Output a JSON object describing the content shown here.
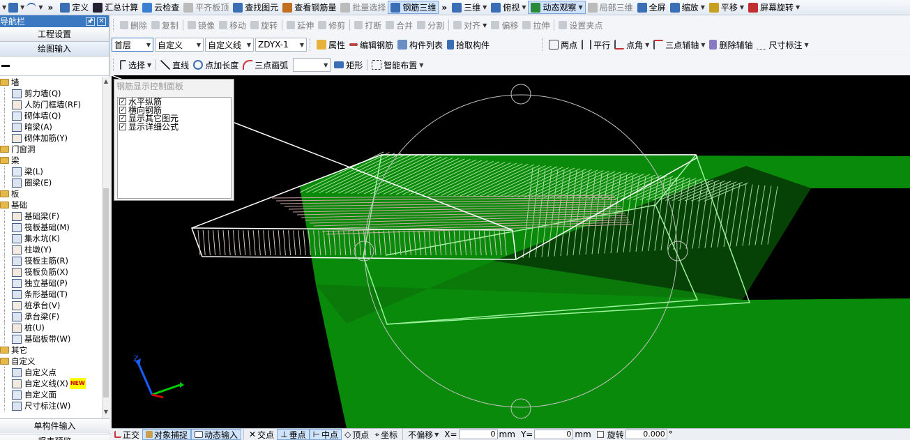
{
  "toolbar_top": {
    "items": [
      {
        "label": "定义",
        "icon": "define-icon",
        "active": false,
        "dim": false
      },
      {
        "label": "汇总计算",
        "icon": "sigma-icon",
        "active": false,
        "dim": false
      },
      {
        "label": "云检查",
        "icon": "cloud-check-icon",
        "active": false,
        "dim": false
      },
      {
        "label": "平齐板顶",
        "icon": "align-slab-icon",
        "active": false,
        "dim": true
      },
      {
        "label": "查找图元",
        "icon": "find-icon",
        "active": false,
        "dim": false
      },
      {
        "label": "查看钢筋量",
        "icon": "view-rebar-icon",
        "active": false,
        "dim": false
      },
      {
        "label": "批量选择",
        "icon": "batch-select-icon",
        "active": false,
        "dim": true
      },
      {
        "label": "钢筋三维",
        "icon": "rebar-3d-icon",
        "active": true,
        "dim": false
      },
      {
        "label": "三维",
        "icon": "cube-icon",
        "active": false,
        "dim": false
      },
      {
        "label": "俯视",
        "icon": "top-view-icon",
        "active": false,
        "dim": false
      },
      {
        "label": "动态观察",
        "icon": "orbit-icon",
        "active": true,
        "dim": false
      },
      {
        "label": "局部三维",
        "icon": "local-3d-icon",
        "active": false,
        "dim": true
      },
      {
        "label": "全屏",
        "icon": "fullscreen-icon",
        "active": false,
        "dim": false
      },
      {
        "label": "缩放",
        "icon": "zoom-icon",
        "active": false,
        "dim": false
      },
      {
        "label": "平移",
        "icon": "pan-icon",
        "active": false,
        "dim": false
      },
      {
        "label": "屏幕旋转",
        "icon": "rotate-screen-icon",
        "active": false,
        "dim": false
      }
    ]
  },
  "nav": {
    "title": "导航栏",
    "engineering_settings": "工程设置",
    "drawing_input": "绘图输入",
    "single_component_input": "单构件输入",
    "report_preview": "报表预览",
    "tree": [
      {
        "type": "cat",
        "label": "墙"
      },
      {
        "type": "leaf",
        "label": "剪力墙(Q)"
      },
      {
        "type": "leaf",
        "label": "人防门框墙(RF)"
      },
      {
        "type": "leaf",
        "label": "砌体墙(Q)"
      },
      {
        "type": "leaf",
        "label": "暗梁(A)"
      },
      {
        "type": "leaf",
        "label": "砌体加筋(Y)"
      },
      {
        "type": "cat",
        "label": "门窗洞"
      },
      {
        "type": "cat",
        "label": "梁"
      },
      {
        "type": "leaf",
        "label": "梁(L)"
      },
      {
        "type": "leaf",
        "label": "圈梁(E)"
      },
      {
        "type": "cat",
        "label": "板"
      },
      {
        "type": "cat",
        "label": "基础"
      },
      {
        "type": "leaf",
        "label": "基础梁(F)"
      },
      {
        "type": "leaf",
        "label": "筏板基础(M)"
      },
      {
        "type": "leaf",
        "label": "集水坑(K)"
      },
      {
        "type": "leaf",
        "label": "柱墩(Y)"
      },
      {
        "type": "leaf",
        "label": "筏板主筋(R)"
      },
      {
        "type": "leaf",
        "label": "筏板负筋(X)"
      },
      {
        "type": "leaf",
        "label": "独立基础(P)"
      },
      {
        "type": "leaf",
        "label": "条形基础(T)"
      },
      {
        "type": "leaf",
        "label": "桩承台(V)"
      },
      {
        "type": "leaf",
        "label": "承台梁(F)"
      },
      {
        "type": "leaf",
        "label": "桩(U)"
      },
      {
        "type": "leaf",
        "label": "基础板带(W)"
      },
      {
        "type": "cat",
        "label": "其它"
      },
      {
        "type": "cat",
        "label": "自定义"
      },
      {
        "type": "leaf",
        "label": "自定义点"
      },
      {
        "type": "leaf",
        "label": "自定义线(X)",
        "badge": "NEW"
      },
      {
        "type": "leaf",
        "label": "自定义面"
      },
      {
        "type": "leaf",
        "label": "尺寸标注(W)"
      }
    ]
  },
  "edit_toolbar": {
    "items": [
      "删除",
      "复制",
      "镜像",
      "移动",
      "旋转",
      "延伸",
      "修剪",
      "打断",
      "合并",
      "分割",
      "对齐",
      "偏移",
      "拉伸",
      "设置夹点"
    ]
  },
  "prop_toolbar": {
    "floor": "首层",
    "category": "自定义",
    "type": "自定义线",
    "name": "ZDYX-1",
    "properties": "属性",
    "edit_rebar": "编辑钢筋",
    "component_list": "构件列表",
    "pick_component": "拾取构件",
    "two_point": "两点",
    "parallel": "平行",
    "point_angle": "点角",
    "three_point_aux": "三点辅轴",
    "delete_aux": "删除辅轴",
    "dimension": "尺寸标注"
  },
  "draw_toolbar": {
    "select": "选择",
    "line": "直线",
    "point_length": "点加长度",
    "three_point_arc": "三点画弧",
    "rectangle": "矩形",
    "smart_layout": "智能布置"
  },
  "rebar_panel": {
    "title": "钢筋显示控制面板",
    "options": [
      {
        "label": "水平纵筋",
        "checked": true
      },
      {
        "label": "横向钢筋",
        "checked": true
      },
      {
        "label": "显示其它图元",
        "checked": true
      },
      {
        "label": "显示详细公式",
        "checked": true
      }
    ]
  },
  "statusbar": {
    "orthogonal": "正交",
    "object_snap": "对象捕捉",
    "dynamic_input": "动态输入",
    "intersection": "交点",
    "perpendicular": "垂点",
    "midpoint": "中点",
    "vertex": "顶点",
    "coordinate": "坐标",
    "no_offset": "不偏移",
    "x_label": "X=",
    "x_value": "0",
    "y_label": "Y=",
    "y_value": "0",
    "unit": "mm",
    "rotate_label": "旋转",
    "rotate_value": "0.000",
    "degree": "°"
  },
  "colors": {
    "viewport_bg": "#000000",
    "slab_fill": "#0a8a0a",
    "slab_outline": "#9df29d",
    "beam_outline": "#ffffff",
    "rebar_longitudinal": "#c8a8a0",
    "rebar_transverse": "#b8e8b0",
    "orbit_circle": "#c0c0c0",
    "axis_x": "#00cc00",
    "axis_y": "#1a5cff",
    "axis_z": "#1a5cff",
    "highlight": "#cfe3fb"
  }
}
